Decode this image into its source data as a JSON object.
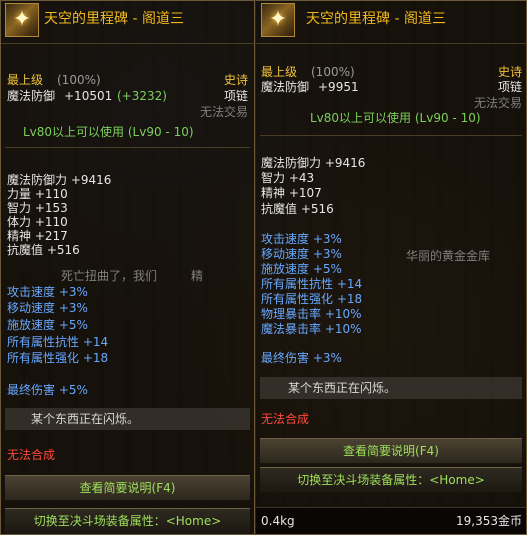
{
  "left": {
    "name": "天空的里程碑 - 阁道三",
    "grade": "最上级",
    "grade_pct": "(100%)",
    "rarity": "史诗",
    "slot": "项链",
    "def_label": "魔法防御",
    "def_value": "+10501",
    "def_bonus": "(+3232)",
    "no_trade": "无法交易",
    "level_req": "Lv80以上可以使用 (Lv90 - 10)",
    "stats": [
      {
        "label": "魔法防御力",
        "value": "+9416"
      },
      {
        "label": "力量",
        "value": "+110"
      },
      {
        "label": "智力",
        "value": "+153"
      },
      {
        "label": "体力",
        "value": "+110"
      },
      {
        "label": "精神",
        "value": "+217"
      },
      {
        "label": "抗魔值",
        "value": "+516"
      }
    ],
    "speed_stats": [
      {
        "label": "攻击速度",
        "value": "+3%"
      },
      {
        "label": "移动速度",
        "value": "+3%"
      },
      {
        "label": "施放速度",
        "value": "+5%"
      },
      {
        "label": "所有属性抗性",
        "value": "+14"
      },
      {
        "label": "所有属性强化",
        "value": "+18"
      }
    ],
    "final_damage": {
      "label": "最终伤害",
      "value": "+5%"
    },
    "flash_text": "某个东西正在闪烁。",
    "no_compose": "无法合成",
    "view_desc": "查看简要说明(F4)",
    "switch_pvp": "切换至决斗场装备属性：<Home>",
    "bg_text_a": "死亡扭曲了，我们",
    "bg_text_b": "精"
  },
  "right": {
    "name": "天空的里程碑 - 阁道三",
    "grade": "最上级",
    "grade_pct": "(100%)",
    "rarity": "史诗",
    "slot": "项链",
    "def_label": "魔法防御",
    "def_value": "+9951",
    "no_trade": "无法交易",
    "level_req": "Lv80以上可以使用 (Lv90 - 10)",
    "stats": [
      {
        "label": "魔法防御力",
        "value": "+9416"
      },
      {
        "label": "智力",
        "value": "+43"
      },
      {
        "label": "精神",
        "value": "+107"
      },
      {
        "label": "抗魔值",
        "value": "+516"
      }
    ],
    "speed_stats": [
      {
        "label": "攻击速度",
        "value": "+3%"
      },
      {
        "label": "移动速度",
        "value": "+3%"
      },
      {
        "label": "施放速度",
        "value": "+5%"
      },
      {
        "label": "所有属性抗性",
        "value": "+14"
      },
      {
        "label": "所有属性强化",
        "value": "+18"
      },
      {
        "label": "物理暴击率",
        "value": "+10%"
      },
      {
        "label": "魔法暴击率",
        "value": "+10%"
      }
    ],
    "final_damage": {
      "label": "最终伤害",
      "value": "+3%"
    },
    "flash_text": "某个东西正在闪烁。",
    "no_compose": "无法合成",
    "view_desc": "查看简要说明(F4)",
    "switch_pvp": "切换至决斗场装备属性：<Home>",
    "weight": "0.4kg",
    "gold": "19,353金币",
    "bg_text": "华丽的黄金金库"
  },
  "colors": {
    "item_name": "#f0b81e",
    "grade": "#f0c238",
    "stat_white": "#e6e6e6",
    "stat_blue": "#67a8ff",
    "level_green": "#7cd05a",
    "no_compose_red": "#ff4a3a"
  },
  "icons": {
    "item": "star-necklace-icon"
  }
}
